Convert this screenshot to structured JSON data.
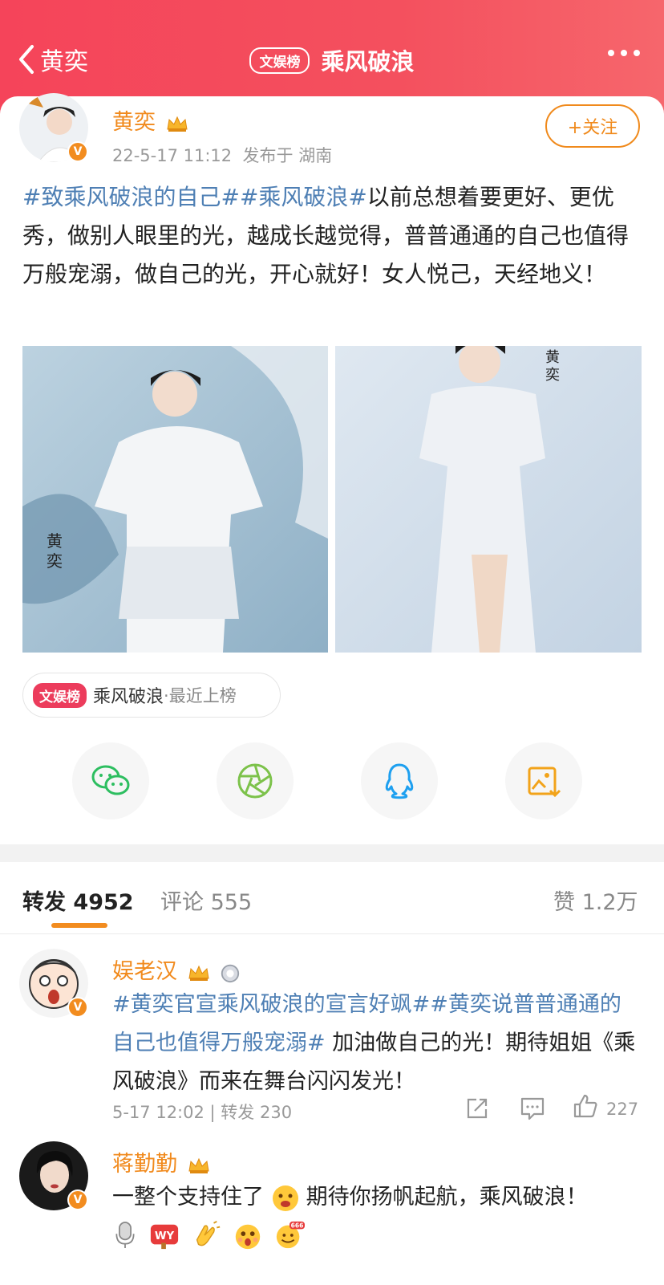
{
  "header": {
    "back_label": "黄奕",
    "badge": "文娱榜",
    "title": "乘风破浪"
  },
  "post": {
    "author": "黄奕",
    "time": "22-5-17 11:12",
    "location": "发布于 湖南",
    "follow_label": "+关注",
    "topic1": "#致乘风破浪的自己#",
    "topic2": "#乘风破浪#",
    "text": "以前总想着要更好、更优秀，做别人眼里的光，越成长越觉得，普普通通的自己也值得万般宠溺，做自己的光，开心就好！女人悦己，天经地义！"
  },
  "tag_chip": {
    "badge": "文娱榜",
    "label": "乘风破浪",
    "sub": "·最近上榜"
  },
  "share": {
    "items": [
      "wechat-icon",
      "moments-icon",
      "qq-icon",
      "save-image-icon"
    ]
  },
  "tabs": {
    "repost_label": "转发",
    "repost_count": "4952",
    "comment_label": "评论",
    "comment_count": "555",
    "like_label": "赞",
    "like_count": "1.2万"
  },
  "comments": [
    {
      "author": "娱老汉",
      "topic1": "#黄奕官宣乘风破浪的宣言好飒#",
      "topic2": "#黄奕说普普通通的自己也值得万般宠溺#",
      "text": " 加油做自己的光！期待姐姐《乘风破浪》而来在舞台闪闪发光！",
      "time": "5-17 12:02",
      "repost": "| 转发 230",
      "likes": "227"
    },
    {
      "author": "蒋勤勤",
      "text_a": "一整个支持住了",
      "text_b": "期待你扬帆起航，乘风破浪！"
    }
  ],
  "colors": {
    "brand_red": "#f4505e",
    "orange": "#f28c1f",
    "topic_blue": "#4e7fb4"
  }
}
